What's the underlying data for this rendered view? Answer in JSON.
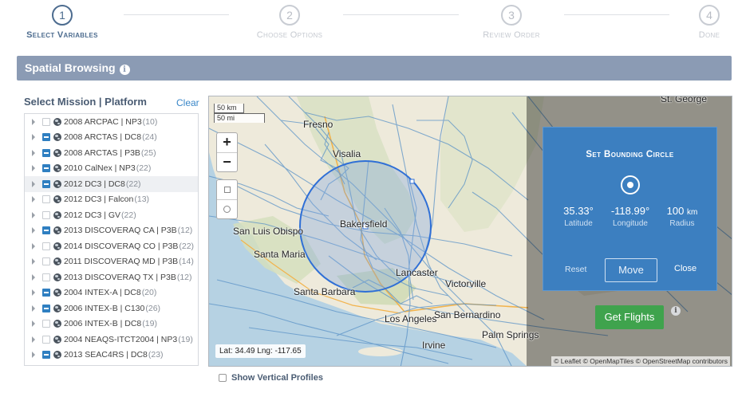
{
  "steps": [
    {
      "num": "1",
      "label": "Select Variables"
    },
    {
      "num": "2",
      "label": "Choose Options"
    },
    {
      "num": "3",
      "label": "Review Order"
    },
    {
      "num": "4",
      "label": "Done"
    }
  ],
  "panel": {
    "title": "Spatial Browsing",
    "info": "i"
  },
  "missions": {
    "title": "Select Mission | Platform",
    "clear": "Clear",
    "items": [
      {
        "label": "2008 ARCPAC | NP3",
        "count": "(10)",
        "checked": false
      },
      {
        "label": "2008 ARCTAS | DC8",
        "count": "(24)",
        "checked": true
      },
      {
        "label": "2008 ARCTAS | P3B",
        "count": "(25)",
        "checked": true
      },
      {
        "label": "2010 CalNex | NP3",
        "count": "(22)",
        "checked": true
      },
      {
        "label": "2012 DC3 | DC8",
        "count": "(22)",
        "checked": true
      },
      {
        "label": "2012 DC3 | Falcon",
        "count": "(13)",
        "checked": false
      },
      {
        "label": "2012 DC3 | GV",
        "count": "(22)",
        "checked": false
      },
      {
        "label": "2013 DISCOVERAQ CA | P3B",
        "count": "(12)",
        "checked": true
      },
      {
        "label": "2014 DISCOVERAQ CO | P3B",
        "count": "(22)",
        "checked": false
      },
      {
        "label": "2011 DISCOVERAQ MD | P3B",
        "count": "(14)",
        "checked": false
      },
      {
        "label": "2013 DISCOVERAQ TX | P3B",
        "count": "(12)",
        "checked": false
      },
      {
        "label": "2004 INTEX-A | DC8",
        "count": "(20)",
        "checked": true
      },
      {
        "label": "2006 INTEX-B | C130",
        "count": "(26)",
        "checked": true
      },
      {
        "label": "2006 INTEX-B | DC8",
        "count": "(19)",
        "checked": false
      },
      {
        "label": "2004 NEAQS-ITCT2004 | NP3",
        "count": "(19)",
        "checked": false
      },
      {
        "label": "2013 SEAC4RS | DC8",
        "count": "(23)",
        "checked": true
      }
    ]
  },
  "map": {
    "scale_km": "50 km",
    "scale_mi": "50 mi",
    "zoom_in": "+",
    "zoom_out": "−",
    "cities": {
      "fresno": "Fresno",
      "visalia": "Visalia",
      "bakersfield": "Bakersfield",
      "san_luis_obispo": "San Luis Obispo",
      "santa_maria": "Santa Maria",
      "santa_barbara": "Santa Barbara",
      "lancaster": "Lancaster",
      "victorville": "Victorville",
      "los_angeles": "Los Angeles",
      "san_bernardino": "San Bernardino",
      "palm_springs": "Palm Springs",
      "irvine": "Irvine",
      "st_george": "St. George"
    },
    "coords": "Lat: 34.49 Lng: -117.65",
    "attribution": "© Leaflet © OpenMapTiles © OpenStreetMap contributors"
  },
  "bounding_circle": {
    "title": "Set Bounding Circle",
    "latitude": "35.33°",
    "longitude": "-118.99°",
    "radius_value": "100",
    "radius_unit": "km",
    "latitude_label": "Latitude",
    "longitude_label": "Longitude",
    "radius_label": "Radius",
    "reset": "Reset",
    "move": "Move",
    "close": "Close"
  },
  "actions": {
    "get_flights": "Get Flights",
    "info": "i"
  },
  "vertical_profiles": "Show Vertical Profiles",
  "colors": {
    "accent": "#4d6c8f",
    "panel_header": "#8b9bb4",
    "circle_panel": "#3c7fc0",
    "get_flights": "#3fa34d"
  }
}
